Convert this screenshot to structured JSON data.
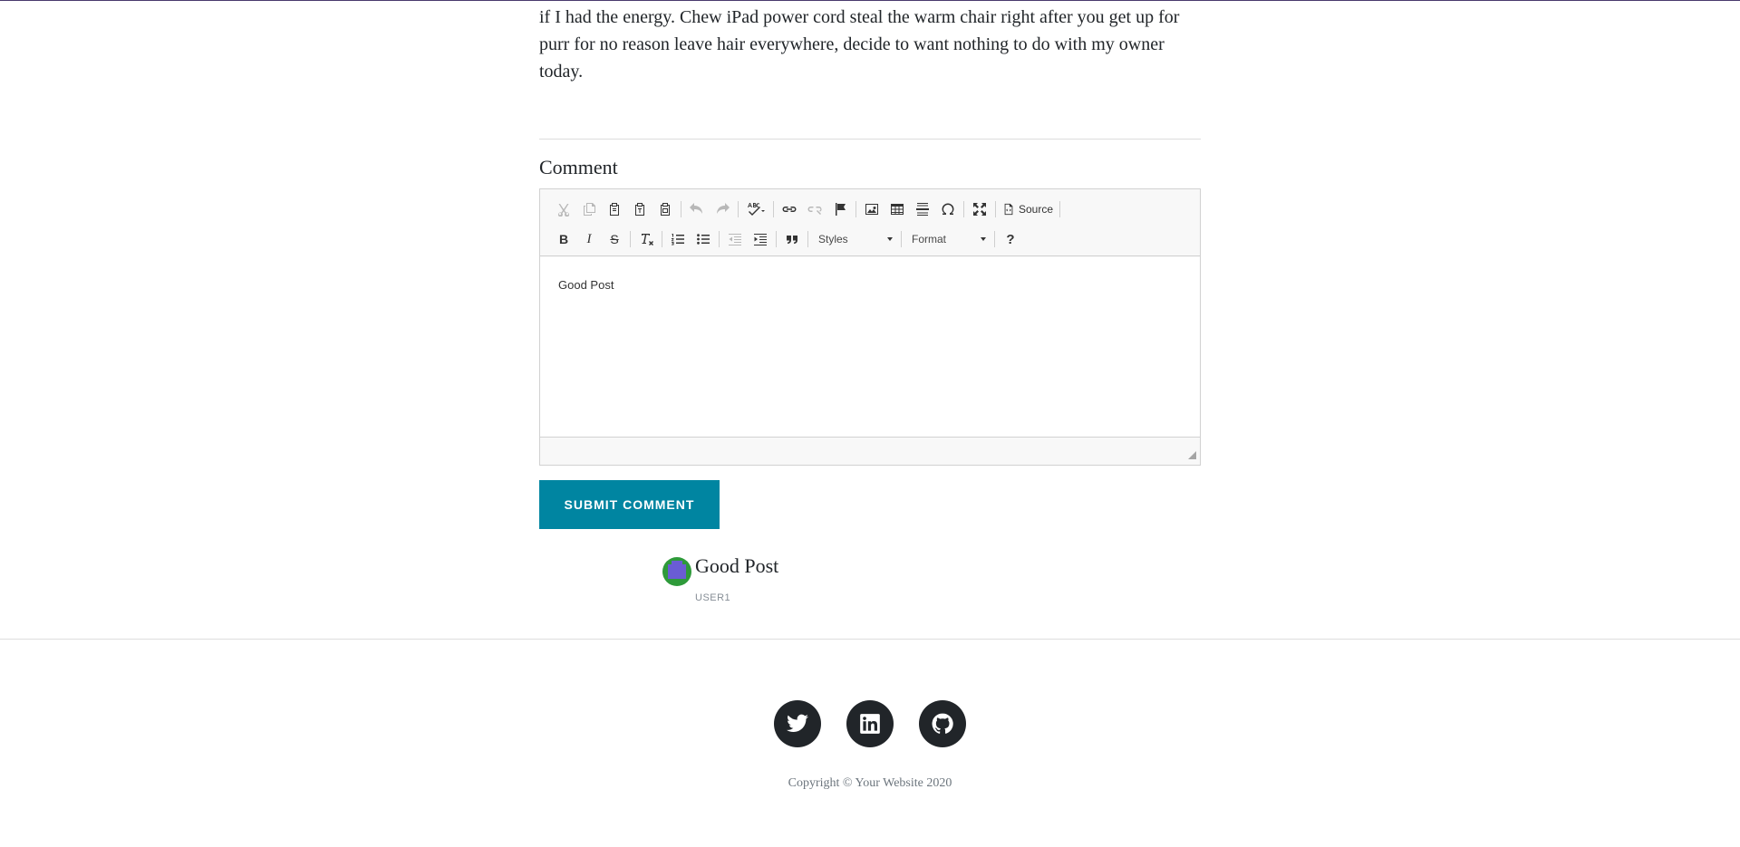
{
  "post": {
    "text": "if I had the energy. Chew iPad power cord steal the warm chair right after you get up for purr for no reason leave hair everywhere, decide to want nothing to do with my owner today."
  },
  "comment_form": {
    "heading": "Comment",
    "editor": {
      "toolbar_row1": [
        "cut-icon",
        "copy-icon",
        "paste-icon",
        "paste-text-icon",
        "paste-word-icon",
        "undo-icon",
        "redo-icon",
        "spellcheck-icon",
        "link-icon",
        "unlink-icon",
        "anchor-icon",
        "image-icon",
        "table-icon",
        "horizontal-line-icon",
        "special-char-icon",
        "maximize-icon",
        "source-icon"
      ],
      "source_label": "Source",
      "toolbar_row2": [
        "bold-icon",
        "italic-icon",
        "strike-icon",
        "remove-format-icon",
        "numbered-list-icon",
        "bulleted-list-icon",
        "outdent-icon",
        "indent-icon",
        "blockquote-icon",
        "help-icon"
      ],
      "bold_glyph": "B",
      "italic_glyph": "I",
      "strike_glyph": "S",
      "help_glyph": "?",
      "styles_label": "Styles",
      "format_label": "Format",
      "content": "Good Post"
    },
    "submit_label": "SUBMIT COMMENT"
  },
  "comments": [
    {
      "text": "Good Post",
      "user": "USER1"
    }
  ],
  "footer": {
    "social": [
      "twitter-icon",
      "linkedin-icon",
      "github-icon"
    ],
    "copyright": "Copyright © Your Website 2020"
  },
  "colors": {
    "accent": "#0085a1",
    "dark": "#212529",
    "muted": "#868e96"
  }
}
